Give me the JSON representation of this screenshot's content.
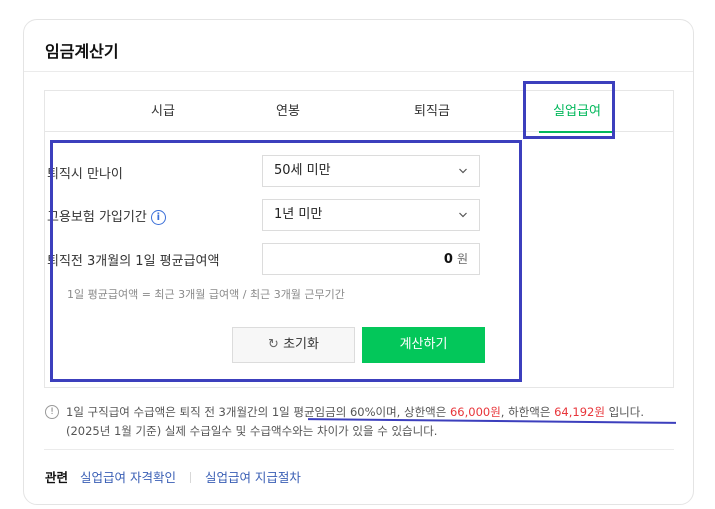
{
  "title": "임금계산기",
  "tabs": [
    {
      "label": "시급",
      "active": false
    },
    {
      "label": "연봉",
      "active": false
    },
    {
      "label": "퇴직금",
      "active": false
    },
    {
      "label": "실업급여",
      "active": true
    }
  ],
  "form": {
    "age_label": "퇴직시 만나이",
    "age_value": "50세 미만",
    "insurance_label": "고용보험 가입기간",
    "insurance_value": "1년 미만",
    "wage_label": "퇴직전 3개월의 1일 평균급여액",
    "wage_value": "0",
    "wage_unit": "원",
    "formula": "1일 평균급여액 = 최근 3개월 급여액 / 최근 3개월 근무기간"
  },
  "buttons": {
    "reset": "초기화",
    "calc": "계산하기"
  },
  "notice": {
    "part1": "1일 구직급여 수급액은 퇴직 전 3개월간의 1일 평균임금의 60%이며, 상한액은 ",
    "upper": "66,000원",
    "part2": ", 하한액은 ",
    "lower": "64,192원",
    "part3": " 입니다. (2025년 1월 기준) 실제 수급일수 및 수급액수와는 차이가 있을 수 있습니다."
  },
  "footer": {
    "related": "관련",
    "link1": "실업급여 자격확인",
    "link2": "실업급여 지급절차"
  },
  "colors": {
    "accent": "#03c75a",
    "highlight": "#3c3fbd",
    "emphasis": "#e8353a"
  },
  "icons": {
    "info": "info-icon",
    "chevron": "chevron-down-icon",
    "reset": "refresh-icon",
    "notice": "exclamation-icon"
  }
}
